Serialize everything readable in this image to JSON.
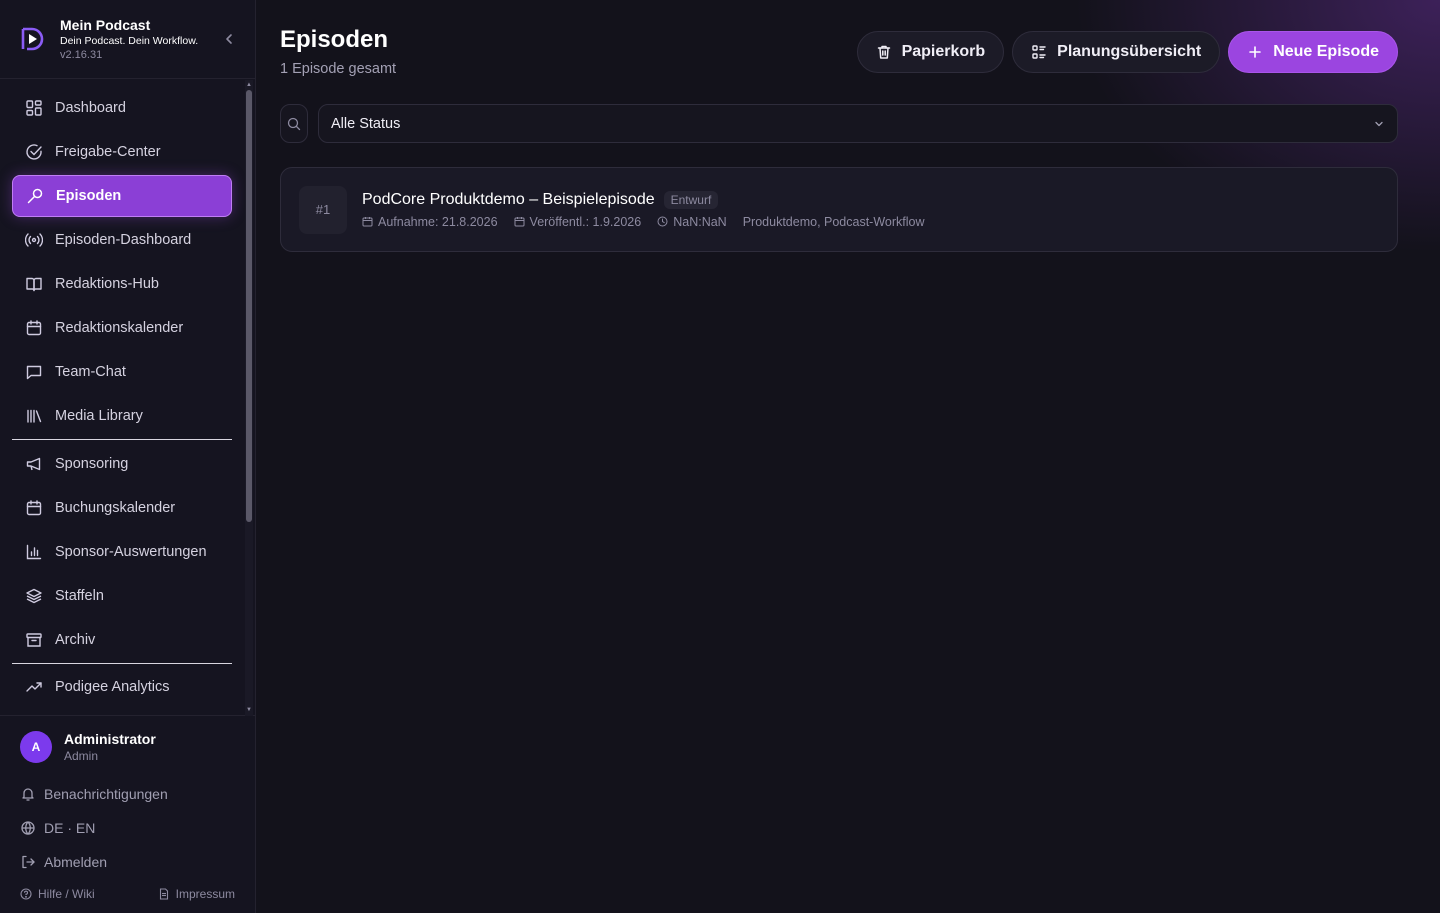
{
  "brand": {
    "title": "Mein Podcast",
    "subtitle": "Dein Podcast. Dein Workflow.",
    "version": "v2.16.31"
  },
  "nav": {
    "group1": [
      {
        "label": "Dashboard",
        "icon": "dashboard-icon"
      },
      {
        "label": "Freigabe-Center",
        "icon": "check-circle-icon"
      },
      {
        "label": "Episoden",
        "icon": "link-icon",
        "active": true
      },
      {
        "label": "Episoden-Dashboard",
        "icon": "broadcast-icon"
      },
      {
        "label": "Redaktions-Hub",
        "icon": "book-icon"
      },
      {
        "label": "Redaktionskalender",
        "icon": "calendar-icon"
      },
      {
        "label": "Team-Chat",
        "icon": "chat-icon"
      },
      {
        "label": "Media Library",
        "icon": "library-icon"
      }
    ],
    "group2": [
      {
        "label": "Sponsoring",
        "icon": "megaphone-icon"
      },
      {
        "label": "Buchungskalender",
        "icon": "calendar-icon"
      },
      {
        "label": "Sponsor-Auswertungen",
        "icon": "bar-chart-icon"
      },
      {
        "label": "Staffeln",
        "icon": "layers-icon"
      },
      {
        "label": "Archiv",
        "icon": "archive-icon"
      }
    ],
    "group3": [
      {
        "label": "Podigee Analytics",
        "icon": "trending-up-icon"
      }
    ]
  },
  "user": {
    "initial": "A",
    "name": "Administrator",
    "role": "Admin"
  },
  "footer": {
    "notifications": "Benachrichtigungen",
    "language": "DE · EN",
    "logout": "Abmelden",
    "help": "Hilfe / Wiki",
    "imprint": "Impressum"
  },
  "page": {
    "title": "Episoden",
    "subtitle": "1 Episode gesamt"
  },
  "actions": {
    "trash": "Papierkorb",
    "planning": "Planungsübersicht",
    "new_episode": "Neue Episode"
  },
  "filter": {
    "status_selected": "Alle Status"
  },
  "episodes": [
    {
      "number": "#1",
      "title": "PodCore Produktdemo – Beispielepisode",
      "status": "Entwurf",
      "recording": "Aufnahme: 21.8.2026",
      "published": "Veröffentl.: 1.9.2026",
      "duration": "NaN:NaN",
      "tags": "Produktdemo, Podcast-Workflow"
    }
  ],
  "colors": {
    "accent": "#9b45e0",
    "active_nav": "#8b3fd6",
    "background": "#13121b",
    "sidebar": "#151420"
  }
}
